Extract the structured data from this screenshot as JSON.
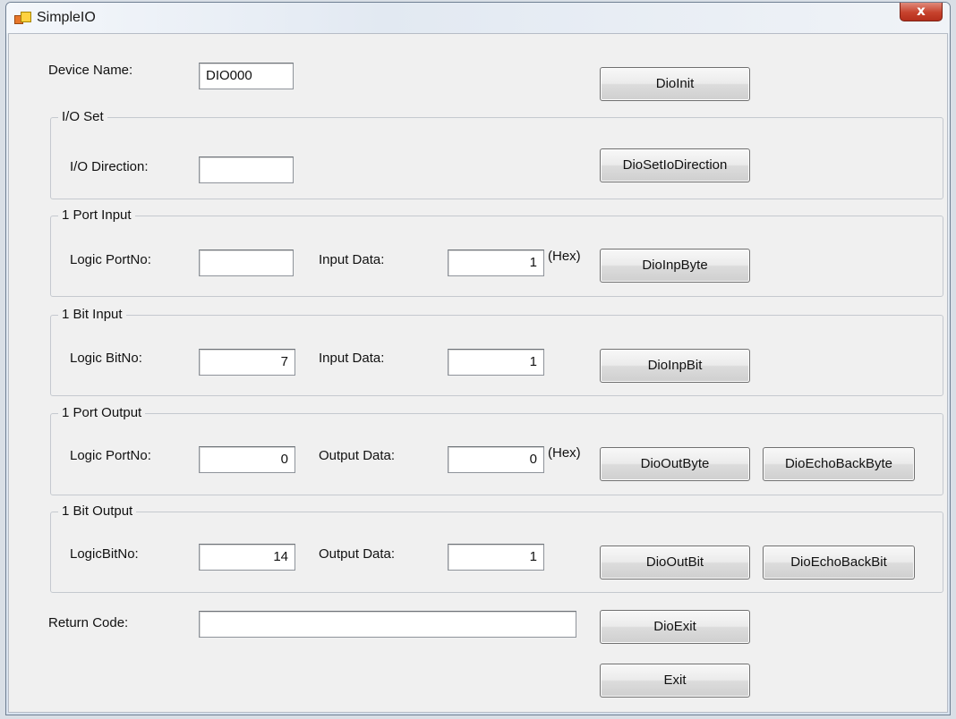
{
  "window": {
    "title": "SimpleIO",
    "close_glyph": "x",
    "app_icon": "app-icon"
  },
  "device": {
    "label": "Device Name:",
    "value": "DIO000",
    "init_button": "DioInit"
  },
  "io_set": {
    "group_title": "I/O Set",
    "direction_label": "I/O Direction:",
    "direction_value": "",
    "button": "DioSetIoDirection"
  },
  "port_input": {
    "group_title": "1 Port Input",
    "port_label": "Logic PortNo:",
    "port_value": "",
    "data_label": "Input Data:",
    "data_value": "1",
    "unit": "(Hex)",
    "button": "DioInpByte"
  },
  "bit_input": {
    "group_title": "1 Bit Input",
    "bit_label": "Logic BitNo:",
    "bit_value": "7",
    "data_label": "Input Data:",
    "data_value": "1",
    "button": "DioInpBit"
  },
  "port_output": {
    "group_title": "1 Port Output",
    "port_label": "Logic PortNo:",
    "port_value": "0",
    "data_label": "Output Data:",
    "data_value": "0",
    "unit": "(Hex)",
    "button": "DioOutByte",
    "echo_button": "DioEchoBackByte"
  },
  "bit_output": {
    "group_title": "1 Bit Output",
    "bit_label": "LogicBitNo:",
    "bit_value": "14",
    "data_label": "Output Data:",
    "data_value": "1",
    "button": "DioOutBit",
    "echo_button": "DioEchoBackBit"
  },
  "return": {
    "label": "Return Code:",
    "value": "",
    "exit_dio_button": "DioExit",
    "exit_button": "Exit"
  }
}
